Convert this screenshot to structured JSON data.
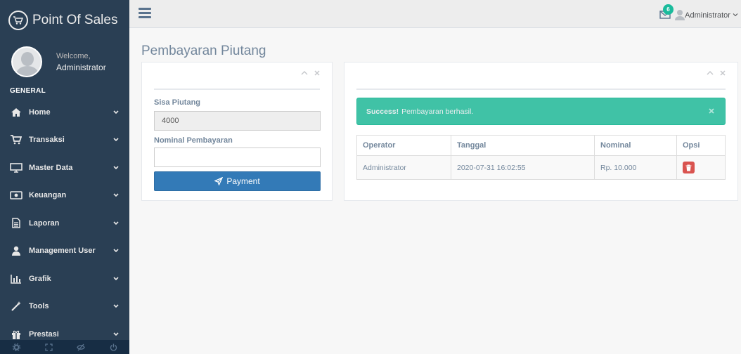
{
  "app": {
    "title": "Point Of Sales"
  },
  "profile": {
    "welcome": "Welcome,",
    "name": "Administrator"
  },
  "sidebar": {
    "section_title": "GENERAL",
    "items": [
      {
        "label": "Home",
        "icon": "home-icon"
      },
      {
        "label": "Transaksi",
        "icon": "cart-icon"
      },
      {
        "label": "Master Data",
        "icon": "desktop-icon"
      },
      {
        "label": "Keuangan",
        "icon": "money-icon"
      },
      {
        "label": "Laporan",
        "icon": "file-icon"
      },
      {
        "label": "Management User",
        "icon": "user-icon"
      },
      {
        "label": "Grafik",
        "icon": "bar-chart-icon"
      },
      {
        "label": "Tools",
        "icon": "magic-wand-icon"
      },
      {
        "label": "Prestasi",
        "icon": "gift-icon"
      }
    ],
    "footer_icons": [
      "settings-icon",
      "fullscreen-icon",
      "eye-slash-icon",
      "power-icon"
    ]
  },
  "topnav": {
    "notification_count": "6",
    "user_name": "Administrator"
  },
  "page": {
    "title": "Pembayaran Piutang"
  },
  "form": {
    "sisa_label": "Sisa Piutang",
    "sisa_value": "4000",
    "nominal_label": "Nominal Pembayaran",
    "nominal_value": "",
    "payment_button": "Payment"
  },
  "alert": {
    "strong": "Success!",
    "message": "Pembayaran berhasil."
  },
  "table": {
    "headers": [
      "Operator",
      "Tanggal",
      "Nominal",
      "Opsi"
    ],
    "rows": [
      {
        "operator": "Administrator",
        "tanggal": "2020-07-31 16:02:55",
        "nominal": "Rp. 10.000"
      }
    ]
  },
  "colors": {
    "sidebar": "#2a3f54",
    "accent": "#1abb9c",
    "primary": "#337ab7",
    "danger": "#d9534f"
  }
}
